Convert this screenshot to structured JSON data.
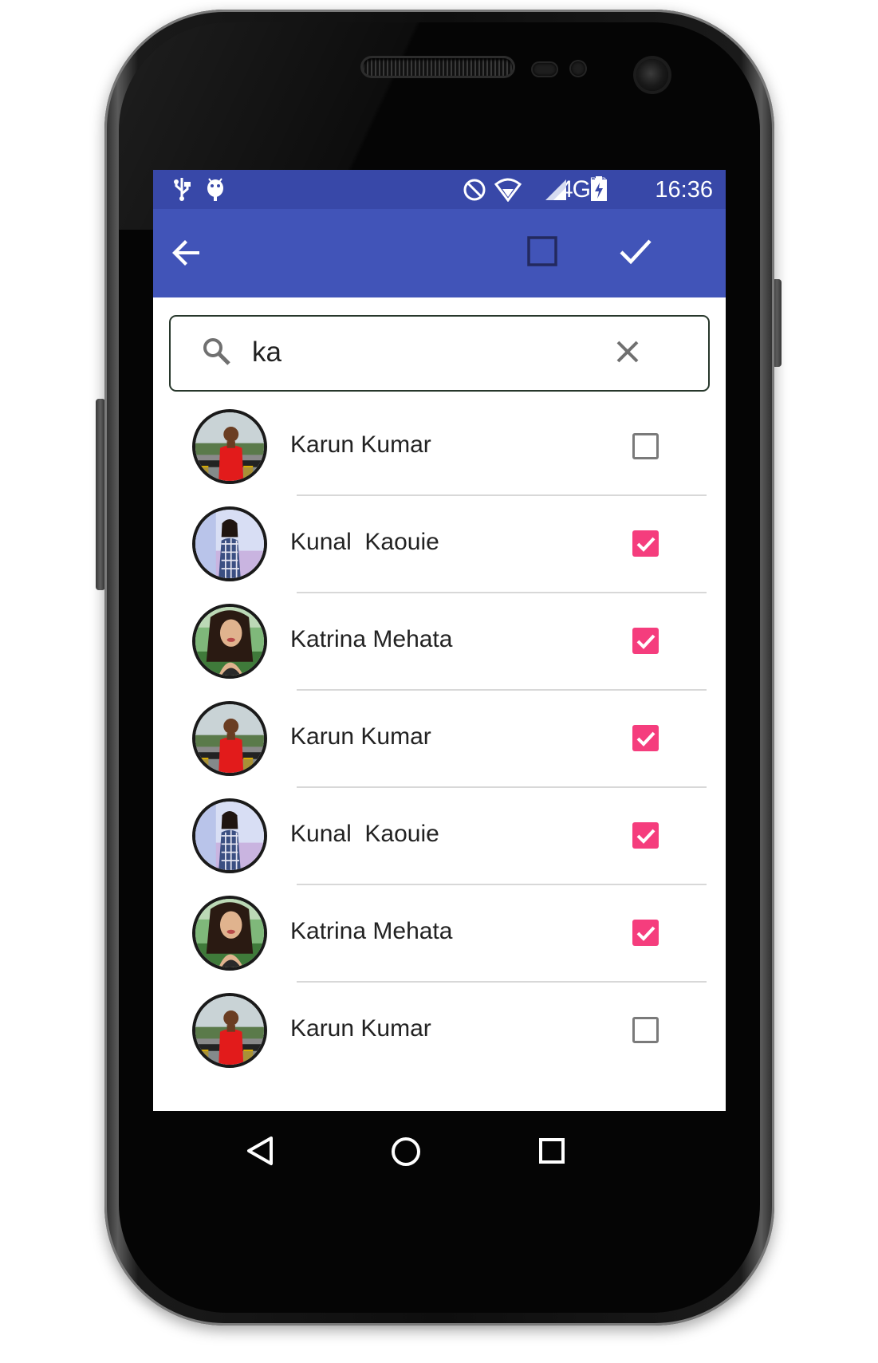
{
  "status_bar": {
    "time": "16:36",
    "network": "4G",
    "network_sub": "R4G",
    "icons": [
      "usb-icon",
      "android-debug-icon",
      "do-not-disturb-icon",
      "wifi-icon",
      "signal-icon",
      "battery-charging-icon"
    ]
  },
  "toolbar": {
    "icons": [
      "back-arrow-icon",
      "select-all-checkbox-icon",
      "done-check-icon"
    ]
  },
  "search": {
    "value": "ka",
    "icons": [
      "search-icon",
      "clear-icon"
    ]
  },
  "contacts": [
    {
      "name": "Karun Kumar",
      "checked": false,
      "avatar": "man-red-shirt"
    },
    {
      "name": "Kunal  Kaouie",
      "checked": true,
      "avatar": "woman-plaid"
    },
    {
      "name": "Katrina Mehata",
      "checked": true,
      "avatar": "woman-green"
    },
    {
      "name": "Karun Kumar",
      "checked": true,
      "avatar": "man-red-shirt"
    },
    {
      "name": "Kunal  Kaouie",
      "checked": true,
      "avatar": "woman-plaid"
    },
    {
      "name": "Katrina Mehata",
      "checked": true,
      "avatar": "woman-green"
    },
    {
      "name": "Karun Kumar",
      "checked": false,
      "avatar": "man-red-shirt"
    }
  ],
  "nav_bar": {
    "icons": [
      "nav-back-icon",
      "nav-home-icon",
      "nav-recents-icon"
    ]
  },
  "colors": {
    "status_bar": "#3848a8",
    "toolbar": "#4154b8",
    "checkbox_checked": "#f53d7d"
  }
}
